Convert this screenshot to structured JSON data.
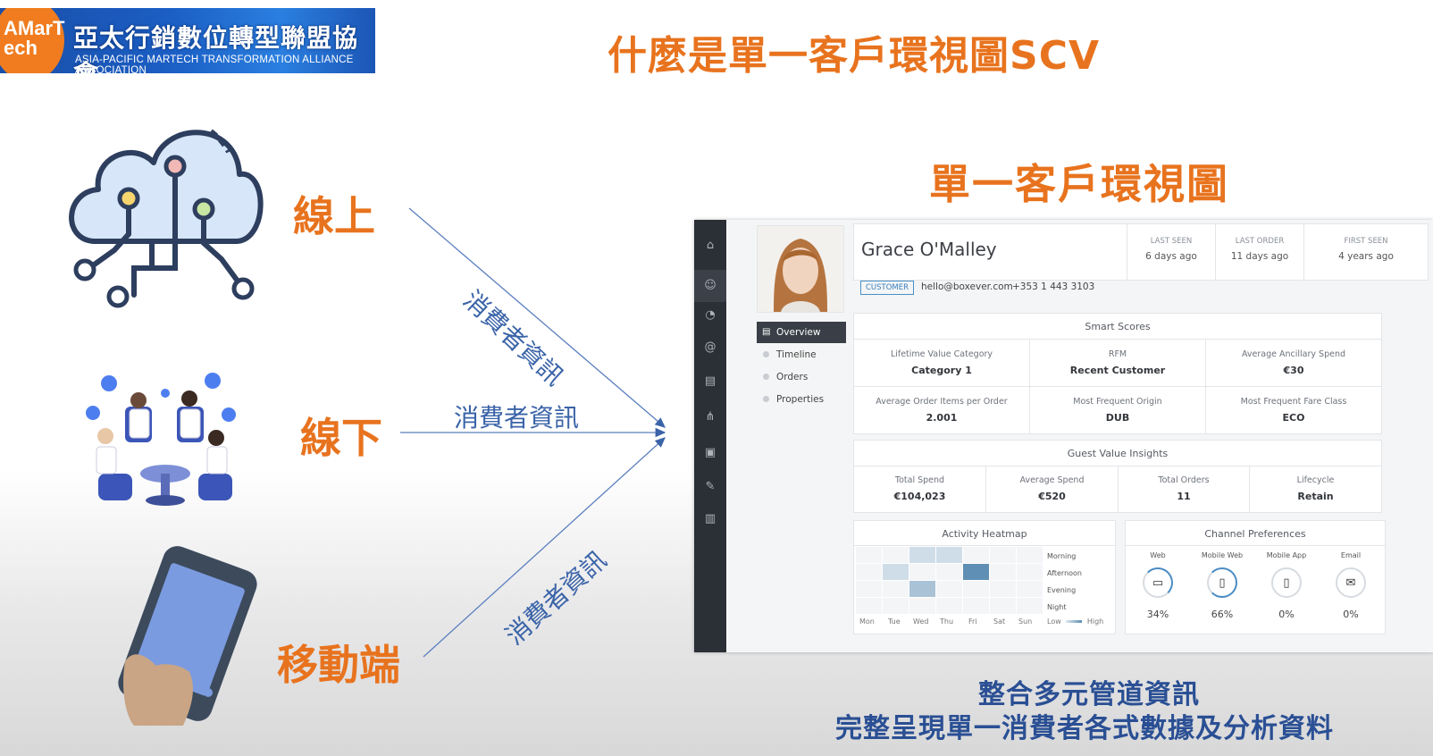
{
  "logo": {
    "mark": "AMarTech",
    "name_zh": "亞太行銷數位轉型聯盟協會",
    "name_en": "ASIA-PACIFIC MARTECH TRANSFORMATION ALLIANCE ASSOCIATION"
  },
  "page_title": "什麼是單一客戶環視圖SCV",
  "section_title": "單一客戶環視圖",
  "sources": [
    {
      "label": "線上",
      "icon": "cloud-circuit-icon"
    },
    {
      "label": "線下",
      "icon": "people-meeting-icon"
    },
    {
      "label": "移動端",
      "icon": "mobile-phone-icon"
    }
  ],
  "flow_label": "消費者資訊",
  "app": {
    "customer": {
      "name": "Grace O'Malley",
      "badge": "CUSTOMER",
      "email": "hello@boxever.com",
      "phone": "+353 1 443 3103",
      "stats": [
        {
          "label": "LAST SEEN",
          "value": "6 days ago"
        },
        {
          "label": "LAST ORDER",
          "value": "11 days ago"
        },
        {
          "label": "FIRST SEEN",
          "value": "4 years ago"
        }
      ]
    },
    "nav": [
      "Overview",
      "Timeline",
      "Orders",
      "Properties"
    ],
    "smart_scores": {
      "title": "Smart Scores",
      "items": [
        {
          "label": "Lifetime Value Category",
          "value": "Category 1"
        },
        {
          "label": "RFM",
          "value": "Recent Customer"
        },
        {
          "label": "Average Ancillary Spend",
          "value": "€30"
        },
        {
          "label": "Average Order Items per Order",
          "value": "2.001"
        },
        {
          "label": "Most Frequent Origin",
          "value": "DUB"
        },
        {
          "label": "Most Frequent Fare Class",
          "value": "ECO"
        }
      ]
    },
    "guest_value": {
      "title": "Guest Value Insights",
      "items": [
        {
          "label": "Total Spend",
          "value": "€104,023"
        },
        {
          "label": "Average Spend",
          "value": "€520"
        },
        {
          "label": "Total Orders",
          "value": "11"
        },
        {
          "label": "Lifecycle",
          "value": "Retain"
        }
      ]
    },
    "heatmap": {
      "title": "Activity Heatmap",
      "days": [
        "Mon",
        "Tue",
        "Wed",
        "Thu",
        "Fri",
        "Sat",
        "Sun"
      ],
      "periods": [
        "Morning",
        "Afternoon",
        "Evening",
        "Night"
      ],
      "legend_low": "Low",
      "legend_high": "High",
      "cells": [
        [
          0,
          0,
          1,
          1,
          0,
          0,
          0
        ],
        [
          0,
          1,
          0,
          0,
          3,
          0,
          0
        ],
        [
          0,
          0,
          2,
          0,
          0,
          0,
          0
        ],
        [
          0,
          0,
          0,
          0,
          0,
          0,
          0
        ]
      ]
    },
    "channels": {
      "title": "Channel Preferences",
      "items": [
        {
          "label": "Web",
          "value": "34%",
          "icon": "desktop-icon"
        },
        {
          "label": "Mobile Web",
          "value": "66%",
          "icon": "mobile-icon"
        },
        {
          "label": "Mobile App",
          "value": "0%",
          "icon": "mobile-app-icon"
        },
        {
          "label": "Email",
          "value": "0%",
          "icon": "email-icon"
        }
      ]
    }
  },
  "footer": {
    "line1": "整合多元管道資訊",
    "line2": "完整呈現單一消費者各式數據及分析資料"
  }
}
